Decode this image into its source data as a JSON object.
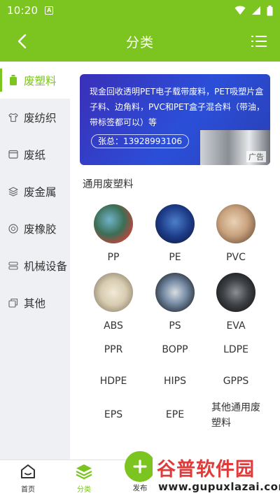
{
  "status_bar": {
    "time": "10:20",
    "notification_glyph": "A"
  },
  "header": {
    "title": "分类"
  },
  "sidebar": {
    "items": [
      {
        "label": "废塑料",
        "icon": "bottle-icon",
        "active": true
      },
      {
        "label": "废纺织",
        "icon": "shirt-icon",
        "active": false
      },
      {
        "label": "废纸",
        "icon": "paper-icon",
        "active": false
      },
      {
        "label": "废金属",
        "icon": "cube-icon",
        "active": false
      },
      {
        "label": "废橡胶",
        "icon": "tire-icon",
        "active": false
      },
      {
        "label": "机械设备",
        "icon": "server-icon",
        "active": false
      },
      {
        "label": "其他",
        "icon": "copy-icon",
        "active": false
      }
    ]
  },
  "banner": {
    "text": "现金回收透明PET电子载带废料，PET吸塑片盒子料、边角料，PVC和PET盒子混合料（带油，带标签都可以）等",
    "phone": "张总：13928993106",
    "ad_label": "广告"
  },
  "section": {
    "title": "通用废塑料"
  },
  "grid": {
    "items": [
      {
        "label": "PP"
      },
      {
        "label": "PE"
      },
      {
        "label": "PVC"
      },
      {
        "label": "ABS"
      },
      {
        "label": "PS"
      },
      {
        "label": "EVA"
      },
      {
        "label": "PPR"
      },
      {
        "label": "BOPP"
      },
      {
        "label": "LDPE"
      },
      {
        "label": "HDPE"
      },
      {
        "label": "HIPS"
      },
      {
        "label": "GPPS"
      },
      {
        "label": "EPS"
      },
      {
        "label": "EPE"
      },
      {
        "label": "其他通用废塑料"
      }
    ]
  },
  "bottom_nav": {
    "home": "首页",
    "category": "分类",
    "publish": "发布"
  },
  "watermark": {
    "main": "谷普软件园",
    "sub": "www.gupuxlazai.com"
  },
  "colors": {
    "accent": "#7cc521",
    "sidebar_bg": "#eef0f3"
  }
}
